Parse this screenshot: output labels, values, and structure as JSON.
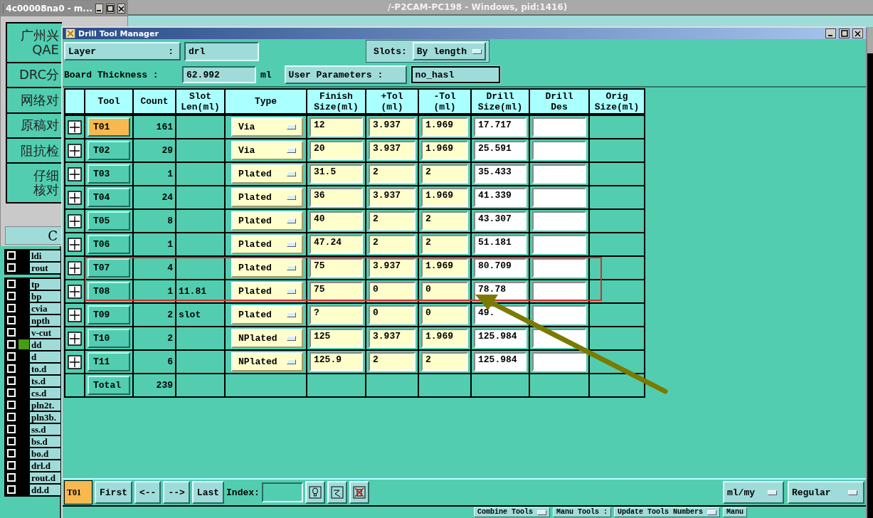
{
  "desktop_title": "/-P2CAM-PC198 - Windows, pid:1416)",
  "side_window": {
    "title": "4c00008na0 - m...",
    "buttons": [
      [
        "广州兴",
        "QAE"
      ],
      [
        "DRC分"
      ],
      [
        "网络对"
      ],
      [
        "原稿对"
      ],
      [
        "阻抗检"
      ],
      [
        "仔细",
        "核对"
      ]
    ],
    "bottom_button": "C"
  },
  "layer_groups": [
    [
      {
        "name": "ldi",
        "checked": false
      },
      {
        "name": "rout",
        "checked": false
      }
    ],
    [
      {
        "name": "tp",
        "checked": false
      },
      {
        "name": "bp",
        "checked": false
      },
      {
        "name": "cvia",
        "checked": false
      },
      {
        "name": "npth",
        "checked": false
      },
      {
        "name": "v-cut",
        "checked": false
      },
      {
        "name": "dd",
        "checked": false,
        "color": "#4a9a12"
      },
      {
        "name": "d",
        "checked": false
      },
      {
        "name": "to.d",
        "checked": false
      },
      {
        "name": "ts.d",
        "checked": false
      },
      {
        "name": "cs.d",
        "checked": false
      },
      {
        "name": "pln2t.",
        "checked": false
      },
      {
        "name": "pln3b.",
        "checked": false
      },
      {
        "name": "ss.d",
        "checked": false
      },
      {
        "name": "bs.d",
        "checked": false
      },
      {
        "name": "bo.d",
        "checked": false
      },
      {
        "name": "drl.d",
        "checked": false
      },
      {
        "name": "rout.d",
        "checked": false
      },
      {
        "name": "dd.d",
        "checked": false
      }
    ]
  ],
  "dialog": {
    "title": "Drill Tool Manager",
    "layer": {
      "label": "Layer",
      "colon": ":",
      "value": "drl"
    },
    "slots": {
      "label": "Slots:",
      "value": "By length"
    },
    "board_thickness": {
      "label": "Board Thickness :",
      "value": "62.992",
      "unit": "ml"
    },
    "user_parameters": {
      "label": "User Parameters :",
      "value": "no_hasl"
    },
    "table": {
      "columns": [
        "",
        "Tool",
        "Count",
        "Slot\nLen(ml)",
        "Type",
        "Finish\nSize(ml)",
        "+Tol\n(ml)",
        "-Tol\n(ml)",
        "Drill\nSize(ml)",
        "Drill\nDes",
        "Orig\nSize(ml)"
      ],
      "rows": [
        {
          "tool": "T01",
          "selected": true,
          "count": "161",
          "slot_len": "",
          "type": "Via",
          "finish": "12",
          "plus_tol": "3.937",
          "minus_tol": "1.969",
          "drill_size": "17.717"
        },
        {
          "tool": "T02",
          "selected": false,
          "count": "29",
          "slot_len": "",
          "type": "Via",
          "finish": "20",
          "plus_tol": "3.937",
          "minus_tol": "1.969",
          "drill_size": "25.591"
        },
        {
          "tool": "T03",
          "selected": false,
          "count": "1",
          "slot_len": "",
          "type": "Plated",
          "finish": "31.5",
          "plus_tol": "2",
          "minus_tol": "2",
          "drill_size": "35.433"
        },
        {
          "tool": "T04",
          "selected": false,
          "count": "24",
          "slot_len": "",
          "type": "Plated",
          "finish": "36",
          "plus_tol": "3.937",
          "minus_tol": "1.969",
          "drill_size": "41.339"
        },
        {
          "tool": "T05",
          "selected": false,
          "count": "8",
          "slot_len": "",
          "type": "Plated",
          "finish": "40",
          "plus_tol": "2",
          "minus_tol": "2",
          "drill_size": "43.307"
        },
        {
          "tool": "T06",
          "selected": false,
          "count": "1",
          "slot_len": "",
          "type": "Plated",
          "finish": "47.24",
          "plus_tol": "2",
          "minus_tol": "2",
          "drill_size": "51.181"
        },
        {
          "tool": "T07",
          "selected": false,
          "count": "4",
          "slot_len": "",
          "type": "Plated",
          "finish": "75",
          "plus_tol": "3.937",
          "minus_tol": "1.969",
          "drill_size": "80.709"
        },
        {
          "tool": "T08",
          "selected": false,
          "count": "1",
          "slot_len": "11.81",
          "type": "Plated",
          "finish": "75",
          "plus_tol": "0",
          "minus_tol": "0",
          "drill_size": "78.78"
        },
        {
          "tool": "T09",
          "selected": false,
          "count": "2",
          "slot_len": "slot",
          "type": "Plated",
          "finish": "?",
          "plus_tol": "0",
          "minus_tol": "0",
          "drill_size": "49."
        },
        {
          "tool": "T10",
          "selected": false,
          "count": "2",
          "slot_len": "",
          "type": "NPlated",
          "finish": "125",
          "plus_tol": "3.937",
          "minus_tol": "1.969",
          "drill_size": "125.984"
        },
        {
          "tool": "T11",
          "selected": false,
          "count": "6",
          "slot_len": "",
          "type": "NPlated",
          "finish": "125.9",
          "plus_tol": "2",
          "minus_tol": "2",
          "drill_size": "125.984"
        }
      ],
      "total": {
        "label": "Total",
        "count": "239"
      }
    },
    "nav": {
      "current": "T01",
      "buttons": [
        "First",
        "<--",
        "-->",
        "Last"
      ],
      "index_label": "Index:",
      "units": "ml/my",
      "mode": "Regular"
    },
    "bottom_buttons": [
      "Combine Tools",
      "Manu Tools :",
      "Update Tools Numbers",
      "Manu"
    ]
  }
}
